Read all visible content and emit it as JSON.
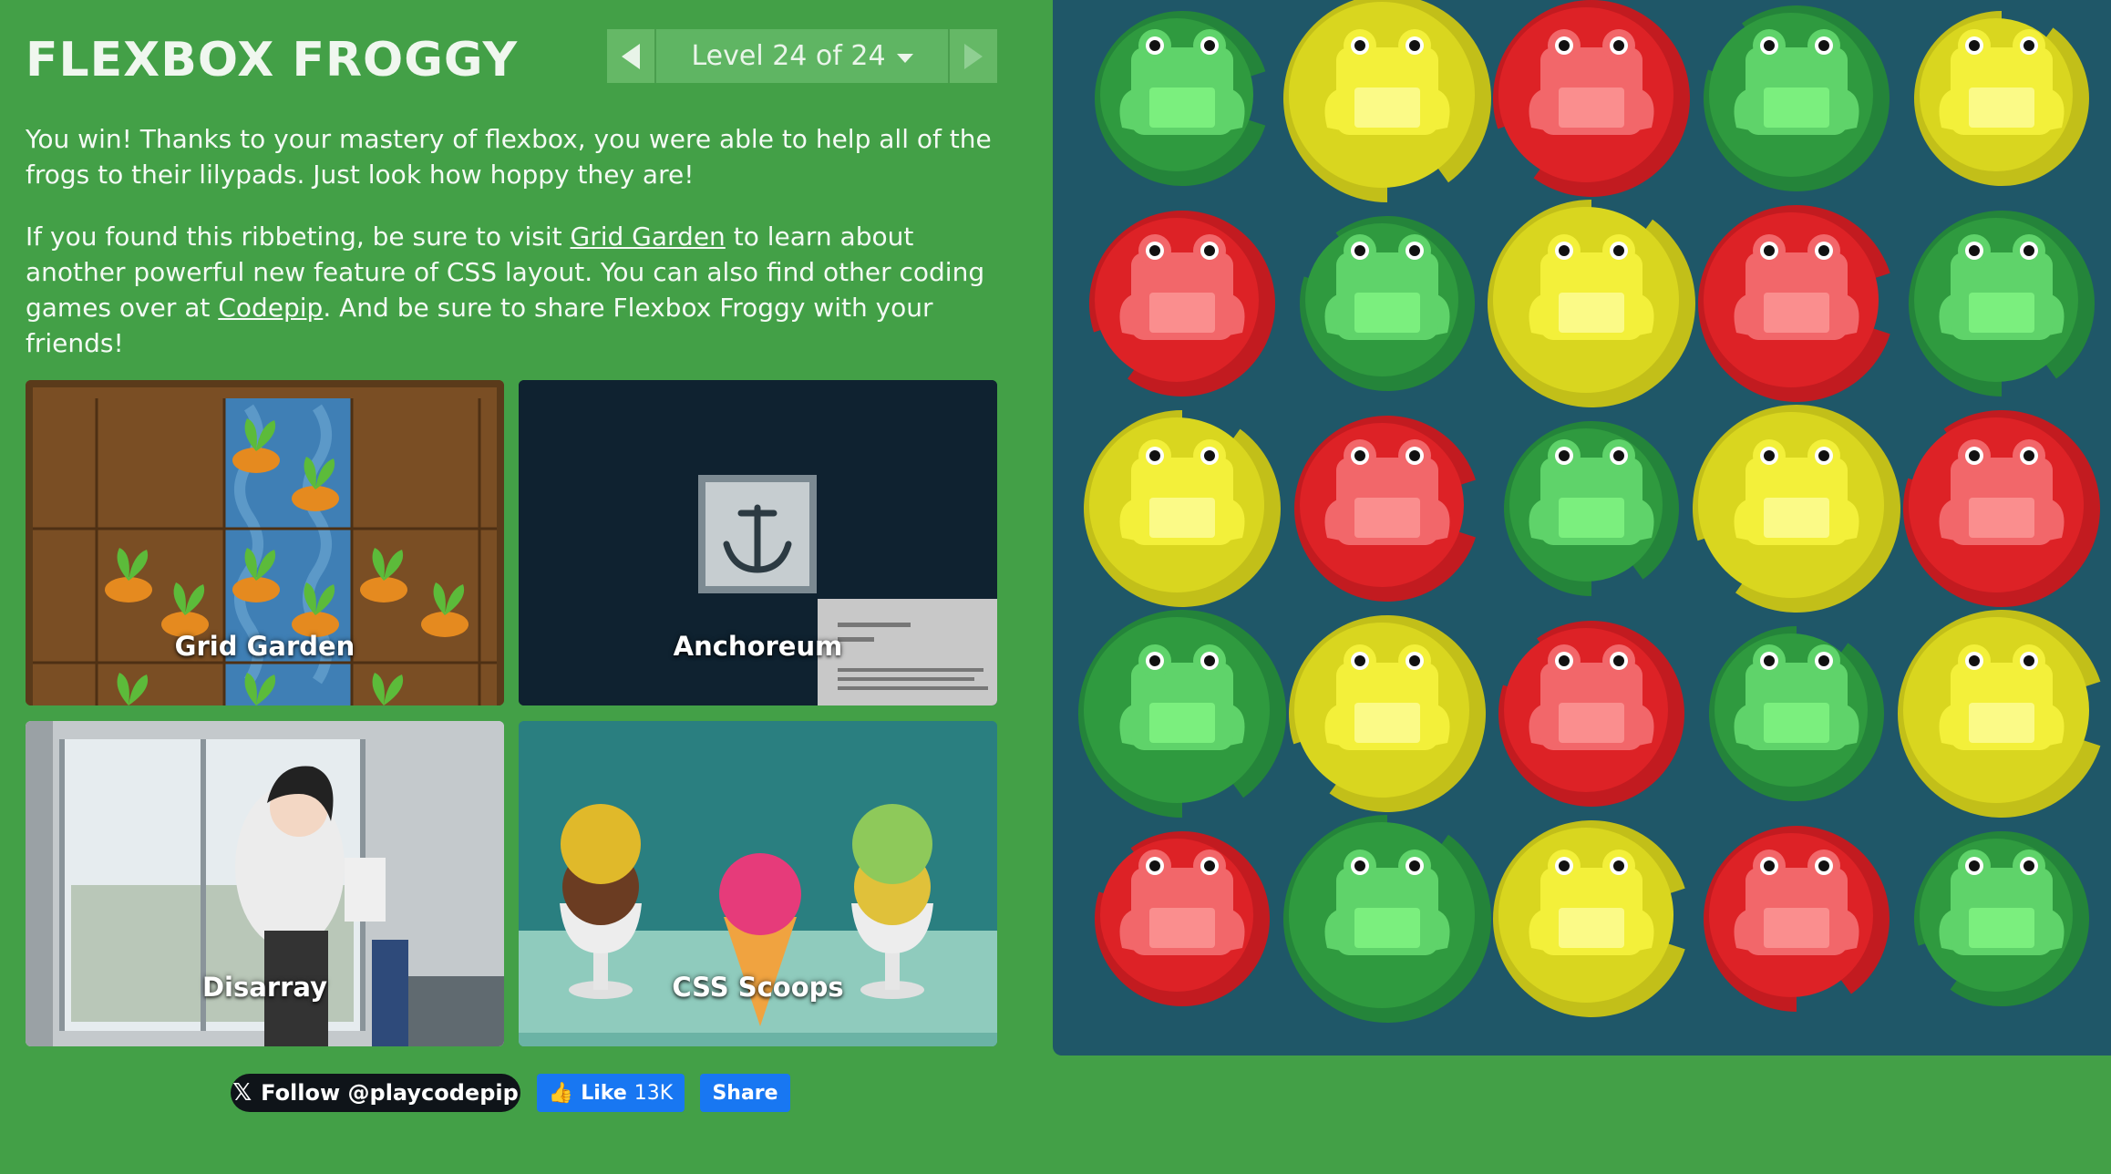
{
  "header": {
    "title": "FLEXBOX FROGGY",
    "level_label": "Level 24 of 24"
  },
  "content": {
    "p1": "You win! Thanks to your mastery of flexbox, you were able to help all of the frogs to their lilypads. Just look how hoppy they are!",
    "p2_part1": "If you found this ribbeting, be sure to visit ",
    "p2_link1": "Grid Garden",
    "p2_part2": " to learn about another powerful new feature of CSS layout. You can also find other coding games over at ",
    "p2_link2": "Codepip",
    "p2_part3": ". And be sure to share Flexbox Froggy with your friends!"
  },
  "games": [
    {
      "name": "Grid Garden"
    },
    {
      "name": "Anchoreum"
    },
    {
      "name": "Disarray"
    },
    {
      "name": "CSS Scoops"
    }
  ],
  "social": {
    "follow_label": "Follow @playcodepip",
    "like_label": "Like",
    "like_count": "13K",
    "share_label": "Share"
  },
  "colors": {
    "background": "#43a047",
    "pond": "#1f5768",
    "green": "#2f9a3f",
    "yellow": "#d9d61f",
    "red": "#dd2226"
  },
  "pond": {
    "rows": [
      [
        "green",
        "yellow",
        "red",
        "green",
        "yellow"
      ],
      [
        "red",
        "green",
        "yellow",
        "red",
        "green"
      ],
      [
        "yellow",
        "red",
        "green",
        "yellow",
        "red"
      ],
      [
        "green",
        "yellow",
        "red",
        "green",
        "yellow"
      ],
      [
        "red",
        "green",
        "yellow",
        "red",
        "green"
      ]
    ]
  }
}
